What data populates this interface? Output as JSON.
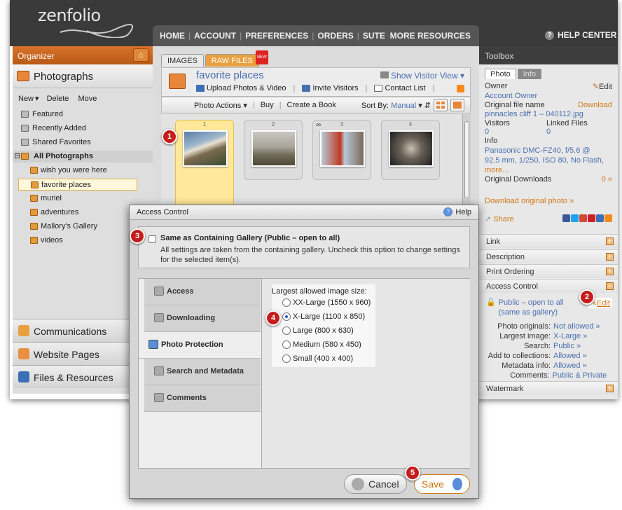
{
  "app": {
    "logo": "zenfolio",
    "nav": [
      "HOME",
      "ACCOUNT",
      "PREFERENCES",
      "ORDERS",
      "SUTE"
    ],
    "more": "MORE RESOURCES",
    "help": "HELP CENTER"
  },
  "organizer": {
    "title": "Organizer",
    "section": "Photographs",
    "actions": [
      "New",
      "Delete",
      "Move"
    ],
    "system_items": [
      "Featured",
      "Recently Added",
      "Shared Favorites"
    ],
    "root": "All Photographs",
    "galleries": [
      "wish you were here",
      "favorite places",
      "muriel",
      "adventures",
      "Mallory's Gallery",
      "videos"
    ],
    "bottom": [
      "Communications",
      "Website Pages",
      "Files & Resources"
    ]
  },
  "gallery": {
    "tabs": [
      "IMAGES",
      "RAW FILES"
    ],
    "new_badge": "NEW",
    "title": "favorite places",
    "visitor_view": "Show Visitor View",
    "links": [
      "Upload Photos & Video",
      "Invite Visitors",
      "Contact List"
    ],
    "toolbar": {
      "photo_actions": "Photo Actions",
      "buy": "Buy",
      "create_book": "Create a Book",
      "sort_by": "Sort By:",
      "sort_value": "Manual"
    },
    "thumbs": [
      "1",
      "2",
      "3",
      "4"
    ]
  },
  "toolbox": {
    "title": "Toolbox",
    "tabs": [
      "Photo",
      "Info"
    ],
    "owner_label": "Owner",
    "edit": "Edit",
    "owner": "Account Owner",
    "orig_name_label": "Original file name",
    "download": "Download",
    "filename": "pinnacles cliff 1 – 040112.jpg",
    "visitors_label": "Visitors",
    "linked_label": "Linked Files",
    "visitors": "0",
    "linked": "0",
    "info_label": "Info",
    "info1": "Panasonic DMC-FZ40, f/5.6 @",
    "info2": "92.5 mm, 1/250, ISO 80, No Flash,",
    "info_more": "more...",
    "orig_dl_label": "Original Downloads",
    "orig_dl_value": "0 »",
    "download_original": "Download original photo »",
    "share": "Share",
    "accordions": [
      "Link",
      "Description",
      "Print Ordering",
      "Access Control",
      "Watermark"
    ],
    "access_value1": "Public – open to all",
    "access_value2": "(same as gallery)",
    "access_edit": "Edit",
    "details": [
      {
        "k": "Photo originals:",
        "v": "Not allowed »"
      },
      {
        "k": "Largest image:",
        "v": "X-Large »"
      },
      {
        "k": "Search:",
        "v": "Public »"
      },
      {
        "k": "Add to collections:",
        "v": "Allowed »"
      },
      {
        "k": "Metadata info:",
        "v": "Allowed »"
      },
      {
        "k": "Comments:",
        "v": "Public & Private »"
      }
    ]
  },
  "dialog": {
    "title": "Access Control",
    "help": "Help",
    "same_as": "Same as Containing Gallery (Public – open to all)",
    "same_desc": "All settings are taken from the containing gallery. Uncheck this option to change settings for the selected item(s).",
    "side": [
      "Access",
      "Downloading",
      "Photo Protection",
      "Search and Metadata",
      "Comments"
    ],
    "largest_label": "Largest allowed image size:",
    "sizes": [
      "XX-Large (1550 x 960)",
      "X-Large (1100 x 850)",
      "Large (800 x 630)",
      "Medium (580 x 450)",
      "Small (400 x 400)"
    ],
    "selected_size": "X-Large (1100 x 850)",
    "cancel": "Cancel",
    "save": "Save"
  },
  "callouts": [
    "1",
    "2",
    "3",
    "4",
    "5"
  ],
  "colors": {
    "accent": "#d9722a",
    "link": "#4a6fb0",
    "callout": "#c51c1c"
  }
}
